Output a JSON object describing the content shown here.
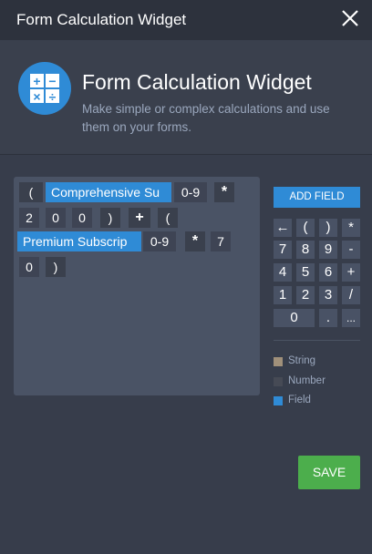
{
  "window": {
    "title": "Form Calculation Widget",
    "close_icon": "close-icon"
  },
  "header": {
    "icon": "calculator-icon",
    "icon_symbols": [
      "+",
      "−",
      "×",
      "÷"
    ],
    "title": "Form Calculation Widget",
    "description": "Make simple or complex calculations and use them on your forms."
  },
  "formula": {
    "tokens": [
      {
        "text": "(",
        "kind": "operator"
      },
      {
        "text": "Comprehensive Su",
        "kind": "field"
      },
      {
        "text": "0-9",
        "kind": "number"
      },
      {
        "text": "*",
        "kind": "operator"
      },
      {
        "text": "2",
        "kind": "number"
      },
      {
        "text": "0",
        "kind": "number"
      },
      {
        "text": "0",
        "kind": "number"
      },
      {
        "text": ")",
        "kind": "operator"
      },
      {
        "text": "+",
        "kind": "operator"
      },
      {
        "text": "(",
        "kind": "operator"
      },
      {
        "text": "Premium Subscrip",
        "kind": "field"
      },
      {
        "text": "0-9",
        "kind": "number"
      },
      {
        "text": "*",
        "kind": "operator"
      },
      {
        "text": "7",
        "kind": "number"
      },
      {
        "text": "0",
        "kind": "number"
      },
      {
        "text": ")",
        "kind": "operator"
      }
    ]
  },
  "add_field_label": "ADD FIELD",
  "keypad": {
    "keys": [
      "←",
      "(",
      ")",
      "*",
      "7",
      "8",
      "9",
      "-",
      "4",
      "5",
      "6",
      "+",
      "1",
      "2",
      "3",
      "/",
      "0",
      ".",
      "..."
    ]
  },
  "legend": {
    "items": [
      {
        "label": "String",
        "color": "#a0907a"
      },
      {
        "label": "Number",
        "color": "#464a55"
      },
      {
        "label": "Field",
        "color": "#2f8bd6"
      }
    ]
  },
  "save_label": "SAVE"
}
